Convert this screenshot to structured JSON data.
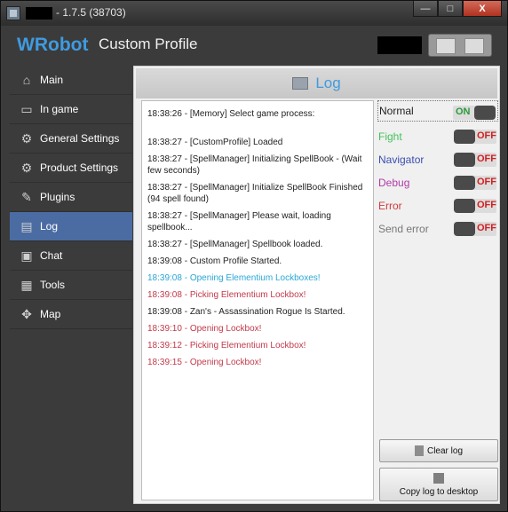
{
  "window": {
    "title_version": "- 1.7.5 (38703)",
    "buttons": {
      "minimize": "—",
      "maximize": "□",
      "close": "X"
    }
  },
  "header": {
    "brand": "WRobot",
    "profile_title": "Custom Profile"
  },
  "sidebar": {
    "items": [
      {
        "label": "Main",
        "icon": "home-icon",
        "glyph": "⌂"
      },
      {
        "label": "In game",
        "icon": "monitor-icon",
        "glyph": "▭"
      },
      {
        "label": "General Settings",
        "icon": "gear-icon",
        "glyph": "⚙"
      },
      {
        "label": "Product Settings",
        "icon": "gears-icon",
        "glyph": "⚙"
      },
      {
        "label": "Plugins",
        "icon": "plug-icon",
        "glyph": "✎"
      },
      {
        "label": "Log",
        "icon": "log-icon",
        "glyph": "▤"
      },
      {
        "label": "Chat",
        "icon": "chat-icon",
        "glyph": "▣"
      },
      {
        "label": "Tools",
        "icon": "calculator-icon",
        "glyph": "▦"
      },
      {
        "label": "Map",
        "icon": "map-icon",
        "glyph": "✥"
      }
    ],
    "active": "Log"
  },
  "content": {
    "title": "Log",
    "log_lines": [
      {
        "text": "18:38:26 - [Memory] Select game process:",
        "color": "#222222",
        "extra_gap": true
      },
      {
        "text": "18:38:27 - [CustomProfile] Loaded",
        "color": "#222222"
      },
      {
        "text": "18:38:27 - [SpellManager] Initializing SpellBook - (Wait few seconds)",
        "color": "#222222"
      },
      {
        "text": "18:38:27 - [SpellManager] Initialize SpellBook Finished (94 spell found)",
        "color": "#222222"
      },
      {
        "text": "18:38:27 - [SpellManager] Please wait, loading spellbook...",
        "color": "#222222"
      },
      {
        "text": "18:38:27 - [SpellManager] Spellbook loaded.",
        "color": "#222222"
      },
      {
        "text": "18:39:08 - Custom Profile Started.",
        "color": "#222222"
      },
      {
        "text": "18:39:08 - Opening Elementium Lockboxes!",
        "color": "#2aa7d6"
      },
      {
        "text": "18:39:08 - Picking Elementium Lockbox!",
        "color": "#c23a4a"
      },
      {
        "text": "18:39:08 - Zan's - Assassination Rogue Is Started.",
        "color": "#222222"
      },
      {
        "text": "18:39:10 - Opening Lockbox!",
        "color": "#c23a4a"
      },
      {
        "text": "18:39:12 - Picking Elementium Lockbox!",
        "color": "#c23a4a"
      },
      {
        "text": "18:39:15 - Opening Lockbox!",
        "color": "#c23a4a"
      }
    ],
    "filters": [
      {
        "label": "Normal",
        "state": "ON",
        "label_color": "#222222"
      },
      {
        "label": "Fight",
        "state": "OFF",
        "label_color": "#44c25a"
      },
      {
        "label": "Navigator",
        "state": "OFF",
        "label_color": "#3a4fb0"
      },
      {
        "label": "Debug",
        "state": "OFF",
        "label_color": "#b03aa8"
      },
      {
        "label": "Error",
        "state": "OFF",
        "label_color": "#d23a3a"
      },
      {
        "label": "Send error",
        "state": "OFF",
        "label_color": "#777777"
      }
    ],
    "clear_label": "Clear log",
    "copy_label": "Copy log to desktop"
  },
  "colors": {
    "accent": "#3f9be0",
    "active_nav": "#4b6ca3",
    "on": "#2a9a3a",
    "off": "#d41f1f"
  }
}
